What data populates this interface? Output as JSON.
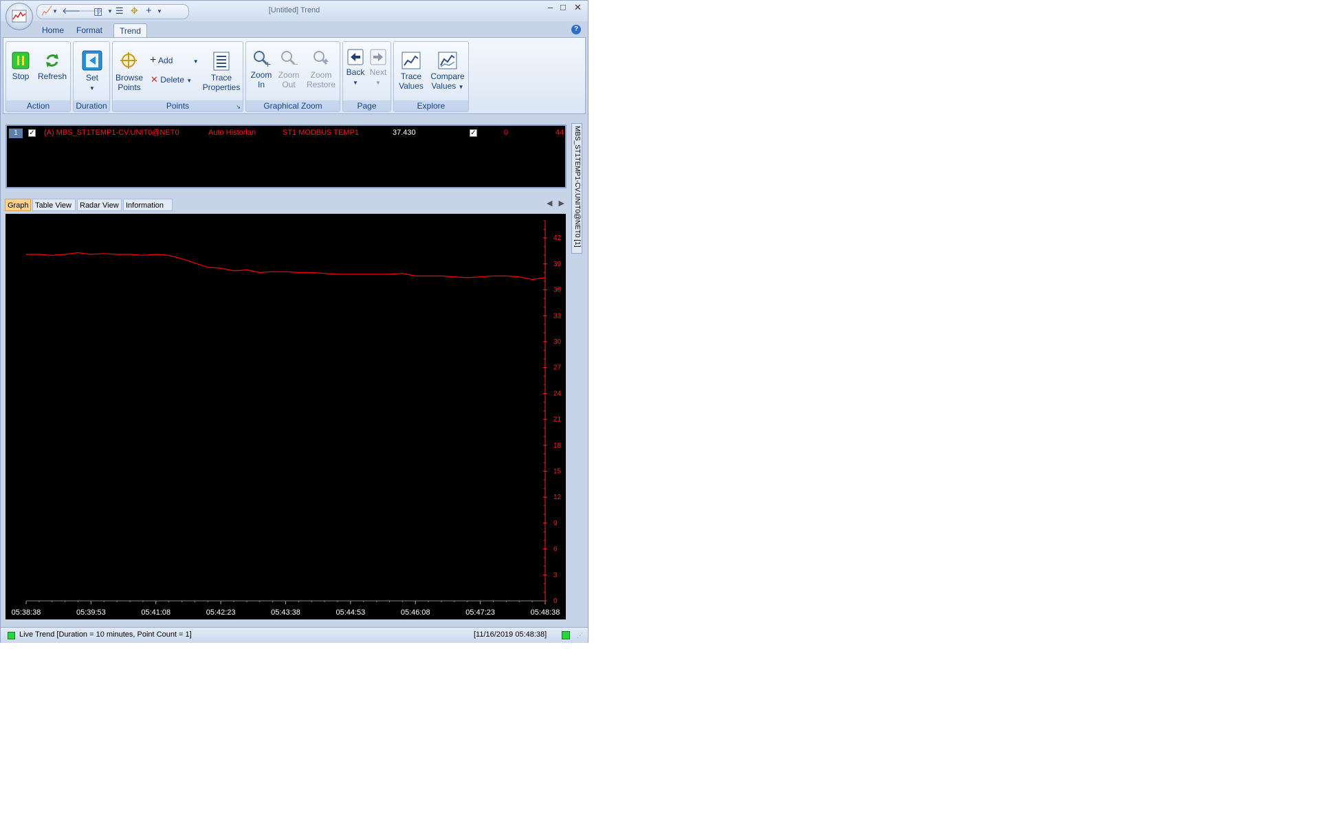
{
  "window": {
    "title": "[Untitled] Trend"
  },
  "tabs": [
    "Home",
    "Format",
    "Trend"
  ],
  "ribbon": {
    "action": {
      "label": "Action",
      "stop": "Stop",
      "refresh": "Refresh"
    },
    "duration": {
      "label": "Duration",
      "set": "Set"
    },
    "points": {
      "label": "Points",
      "browse": "Browse Points",
      "add": "Add",
      "delete": "Delete",
      "trace_properties": "Trace Properties"
    },
    "zoom": {
      "label": "Graphical Zoom",
      "zoom_in": "Zoom In",
      "zoom_out": "Zoom Out",
      "zoom_restore": "Zoom Restore"
    },
    "page": {
      "label": "Page",
      "back": "Back",
      "next": "Next"
    },
    "explore": {
      "label": "Explore",
      "trace_values": "Trace Values",
      "compare_values": "Compare Values"
    }
  },
  "legend": {
    "row_number": "1",
    "tag": "(A) MBS_ST1TEMP1-CV.UNIT0@NET0",
    "source": "Auto Historian",
    "description": "ST1 MODBUS TEMP1",
    "value": "37.430",
    "min": "0",
    "max": "44"
  },
  "side_tab": "MBS_ST1TEMP1-CV.UNIT0@NET0 [1]",
  "view_tabs": [
    "Graph",
    "Table View",
    "Radar View",
    "Information"
  ],
  "chart_data": {
    "type": "line",
    "x_ticks": [
      "05:38:38",
      "05:39:53",
      "05:41:08",
      "05:42:23",
      "05:43:38",
      "05:44:53",
      "05:46:08",
      "05:47:23",
      "05:48:38"
    ],
    "y_ticks": [
      "0",
      "3",
      "6",
      "9",
      "12",
      "15",
      "18",
      "21",
      "24",
      "27",
      "30",
      "33",
      "36",
      "39",
      "42"
    ],
    "ylim": [
      0,
      44
    ],
    "line_color": "#ff0000",
    "series": [
      {
        "x": [
          0,
          1,
          2,
          3,
          4,
          5,
          6,
          7,
          8,
          9,
          10,
          11,
          12,
          13,
          14,
          15,
          16,
          17,
          18,
          19,
          20,
          21,
          22,
          23,
          24,
          25,
          26,
          27,
          28,
          29,
          30,
          31,
          32,
          33,
          34,
          35,
          36,
          37,
          38,
          39,
          40
        ],
        "values": [
          40.1,
          40.1,
          40.0,
          40.1,
          40.3,
          40.1,
          40.2,
          40.1,
          40.1,
          40.0,
          40.1,
          40.0,
          39.6,
          39.1,
          38.6,
          38.5,
          38.2,
          38.3,
          38.0,
          38.1,
          38.1,
          38.0,
          38.0,
          37.9,
          37.8,
          37.8,
          37.8,
          37.8,
          37.8,
          37.9,
          37.6,
          37.6,
          37.6,
          37.5,
          37.4,
          37.5,
          37.6,
          37.6,
          37.5,
          37.2,
          37.4
        ]
      }
    ]
  },
  "status": {
    "text": "Live Trend [Duration = 10 minutes, Point Count = 1]",
    "timestamp": "[11/16/2019 05:48:38]"
  }
}
